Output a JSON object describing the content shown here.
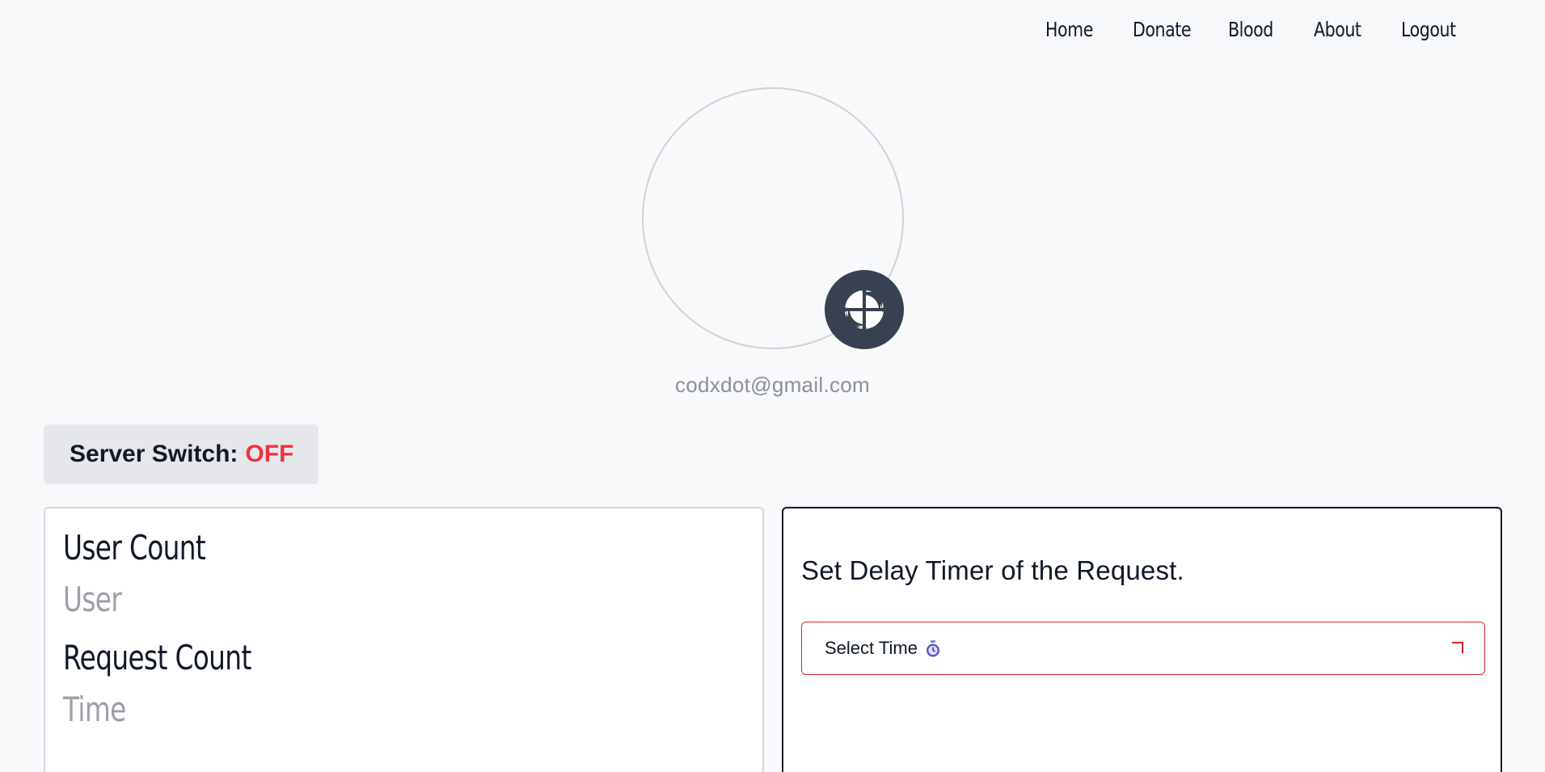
{
  "nav": {
    "items": [
      "Home",
      "Donate",
      "Blood",
      "About",
      "Logout"
    ]
  },
  "profile": {
    "email": "codxdot@gmail.com",
    "badge_icon": "pinwheel-logo-icon"
  },
  "server_switch": {
    "label": "Server Switch:",
    "state": "OFF",
    "state_color": "#ef3340"
  },
  "stats": {
    "user_count_title": "User Count",
    "user_count_value": "User",
    "request_count_title": "Request Count",
    "request_count_value": "Time"
  },
  "delay": {
    "title": "Set Delay Timer of the Request.",
    "select_label": "Select Time",
    "select_icon": "stopwatch-icon",
    "accent": "#dc2626"
  }
}
